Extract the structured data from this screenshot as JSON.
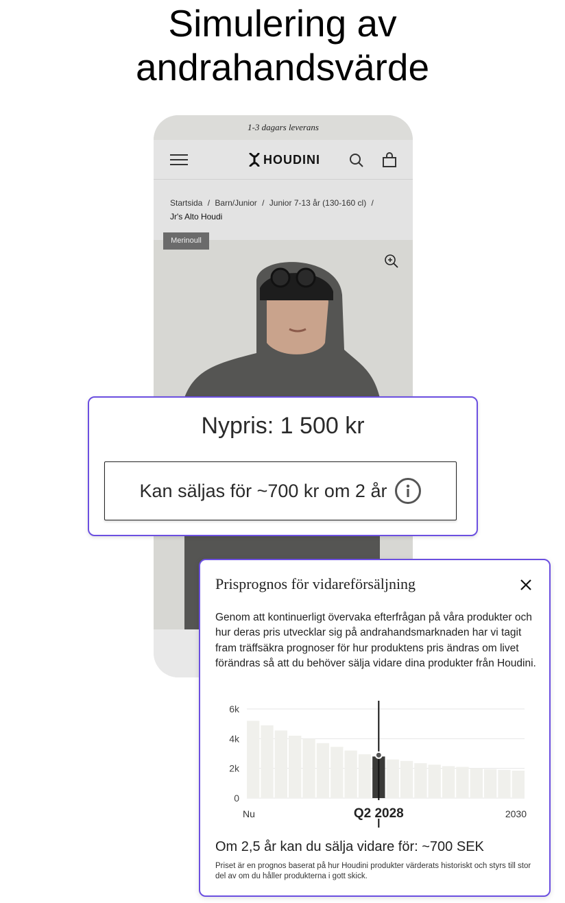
{
  "headline": {
    "line1": "Simulering av",
    "line2": "andrahandsvärde"
  },
  "phone": {
    "promo_text": "1-3 dagars leverans",
    "nav": {
      "menu_icon": "hamburger-icon",
      "brand": "HOUDINI",
      "search_icon": "search-icon",
      "cart_icon": "shopping-bag-icon"
    },
    "breadcrumb": {
      "path": [
        "Startsida",
        "Barn/Junior",
        "Junior 7-13 år (130-160 cl)"
      ],
      "separator": "/",
      "current": "Jr's Alto Houdi"
    },
    "badge": "Merinoull",
    "zoom_icon": "zoom-in-icon"
  },
  "price_card": {
    "new_price": "Nypris: 1 500 kr",
    "resale_label": "Kan säljas för ~700 kr om 2 år",
    "info_icon": "info-icon"
  },
  "modal": {
    "title": "Prisprognos för vidareförsäljning",
    "close_icon": "close-icon",
    "body": "Genom att kontinuerligt övervaka efterfrågan på våra produkter och hur deras pris utvecklar sig på andrahandsmarknaden har vi tagit fram träffsäkra prognoser för hur produktens pris ändras om livet förändras så att du behöver sälja vidare dina produkter från Houdini.",
    "result": "Om 2,5 år kan du sälja vidare för: ~700 SEK",
    "disclaimer": "Priset är en prognos baserat på hur Houdini produkter värderats historiskt och styrs till stor del av om du håller produkterna i gott skick."
  },
  "chart_data": {
    "type": "bar",
    "y_ticks": [
      "6k",
      "4k",
      "2k",
      "0"
    ],
    "y_tick_values": [
      6000,
      4000,
      2000,
      0
    ],
    "ylim": [
      0,
      6000
    ],
    "x_start_label": "Nu",
    "x_end_label": "2030",
    "selected_label": "Q2 2028",
    "selected_index": 9,
    "values": [
      5200,
      4900,
      4550,
      4200,
      4000,
      3700,
      3450,
      3200,
      2950,
      2800,
      2600,
      2500,
      2350,
      2250,
      2150,
      2100,
      2000,
      1950,
      1900,
      1850
    ],
    "bar_color": "#f0f0ec",
    "selected_color": "#3a3a38",
    "grid": true
  }
}
